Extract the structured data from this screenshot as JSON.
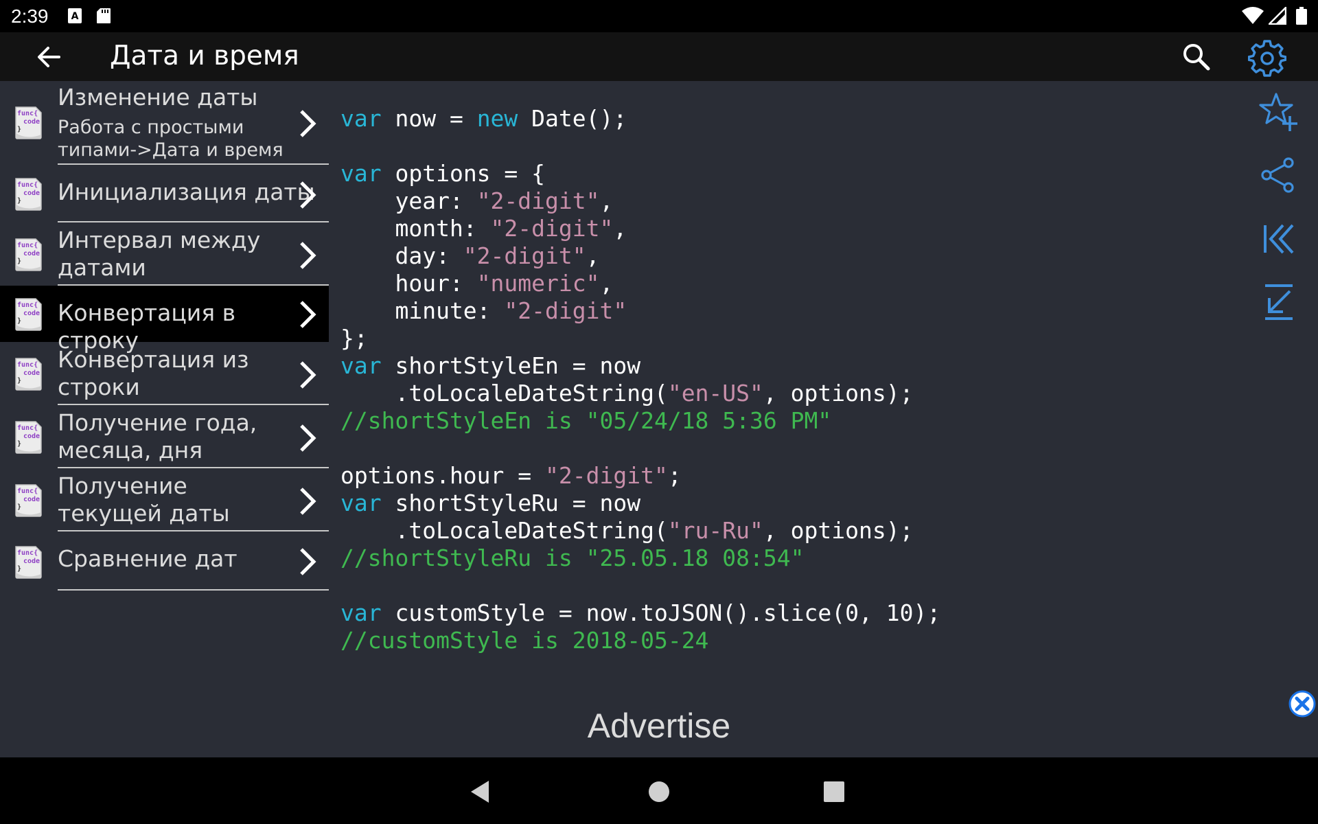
{
  "status_bar": {
    "time": "2:39",
    "icons": [
      "a-notification-icon",
      "sd-card-icon",
      "wifi-icon",
      "signal-icon",
      "battery-icon"
    ]
  },
  "app_bar": {
    "title": "Дата и время",
    "icons": [
      "back-arrow-icon",
      "search-icon",
      "gear-icon"
    ]
  },
  "sidebar": {
    "items": [
      {
        "label": "Изменение даты",
        "sub": "Работа с простыми типами->Дата и время",
        "icon": "func-code-icon"
      },
      {
        "label": "Инициализация даты",
        "icon": "func-code-icon"
      },
      {
        "label": "Интервал между датами",
        "icon": "func-code-icon"
      },
      {
        "label": "Конвертация в строку",
        "icon": "func-code-icon",
        "active": true
      },
      {
        "label": "Конвертация из строки",
        "icon": "func-code-icon"
      },
      {
        "label": "Получение года, месяца, дня",
        "icon": "func-code-icon"
      },
      {
        "label": "Получение текущей даты",
        "icon": "func-code-icon"
      },
      {
        "label": "Сравнение дат",
        "icon": "func-code-icon"
      }
    ]
  },
  "code": [
    [
      [
        "kw",
        "var"
      ],
      [
        "t",
        " now = "
      ],
      [
        "kw",
        "new"
      ],
      [
        "t",
        " Date();"
      ]
    ],
    [],
    [
      [
        "kw",
        "var"
      ],
      [
        "t",
        " options = {"
      ]
    ],
    [
      [
        "t",
        "    year: "
      ],
      [
        "str",
        "\"2-digit\""
      ],
      [
        "t",
        ","
      ]
    ],
    [
      [
        "t",
        "    month: "
      ],
      [
        "str",
        "\"2-digit\""
      ],
      [
        "t",
        ","
      ]
    ],
    [
      [
        "t",
        "    day: "
      ],
      [
        "str",
        "\"2-digit\""
      ],
      [
        "t",
        ","
      ]
    ],
    [
      [
        "t",
        "    hour: "
      ],
      [
        "str",
        "\"numeric\""
      ],
      [
        "t",
        ","
      ]
    ],
    [
      [
        "t",
        "    minute: "
      ],
      [
        "str",
        "\"2-digit\""
      ]
    ],
    [
      [
        "t",
        "};"
      ]
    ],
    [
      [
        "kw",
        "var"
      ],
      [
        "t",
        " shortStyleEn = now"
      ]
    ],
    [
      [
        "t",
        "    .toLocaleDateString("
      ],
      [
        "str",
        "\"en-US\""
      ],
      [
        "t",
        ", options);"
      ]
    ],
    [
      [
        "cm",
        "//shortStyleEn is \"05/24/18 5:36 PM\""
      ]
    ],
    [],
    [
      [
        "t",
        "options.hour = "
      ],
      [
        "str",
        "\"2-digit\""
      ],
      [
        "t",
        ";"
      ]
    ],
    [
      [
        "kw",
        "var"
      ],
      [
        "t",
        " shortStyleRu = now"
      ]
    ],
    [
      [
        "t",
        "    .toLocaleDateString("
      ],
      [
        "str",
        "\"ru-Ru\""
      ],
      [
        "t",
        ", options);"
      ]
    ],
    [
      [
        "cm",
        "//shortStyleRu is \"25.05.18 08:54\""
      ]
    ],
    [],
    [
      [
        "kw",
        "var"
      ],
      [
        "t",
        " customStyle = now.toJSON().slice(0, 10);"
      ]
    ],
    [
      [
        "cm",
        "//customStyle is 2018-05-24"
      ]
    ]
  ],
  "right_toolbar": {
    "icons": [
      "star-add-icon",
      "share-icon",
      "jump-to-start-icon",
      "jump-down-icon"
    ]
  },
  "advertise": {
    "label": "Advertise",
    "close_icon": "close-icon"
  },
  "nav_bar": {
    "icons": [
      "nav-back-icon",
      "nav-home-icon",
      "nav-recents-icon"
    ]
  },
  "colors": {
    "background": "#2a2d36",
    "keyword": "#29b6d6",
    "string": "#c88faa",
    "comment": "#3fb950",
    "accent": "#3f8fdc"
  }
}
